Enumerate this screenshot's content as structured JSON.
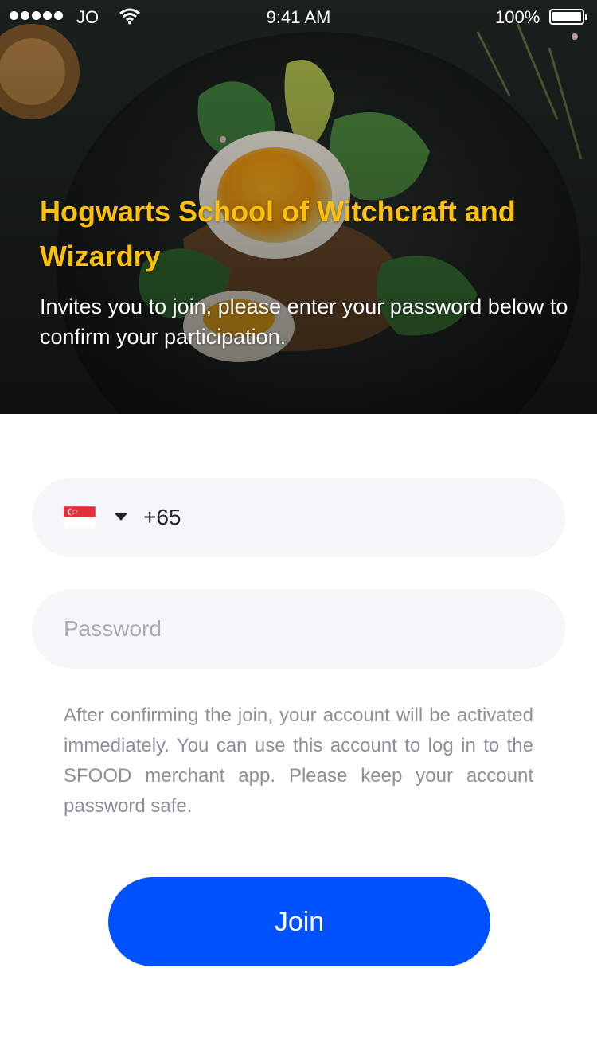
{
  "status_bar": {
    "carrier": "JO",
    "time": "9:41 AM",
    "battery": "100%"
  },
  "hero": {
    "title": "Hogwarts School of Witchcraft and Wizardry",
    "subtitle": "Invites you to join, please enter your password below to confirm your participation."
  },
  "form": {
    "country_flag": "singapore-flag-icon",
    "dial_code": "+65",
    "password_placeholder": "Password",
    "password_value": ""
  },
  "notice": "After confirming the join, your account will be activated immediately. You can use this account to log in to the SFOOD merchant app. Please keep your account password safe.",
  "join_label": "Join",
  "colors": {
    "accent": "#0052ff",
    "title": "#ffc107",
    "field_bg": "#f5f6f8"
  }
}
